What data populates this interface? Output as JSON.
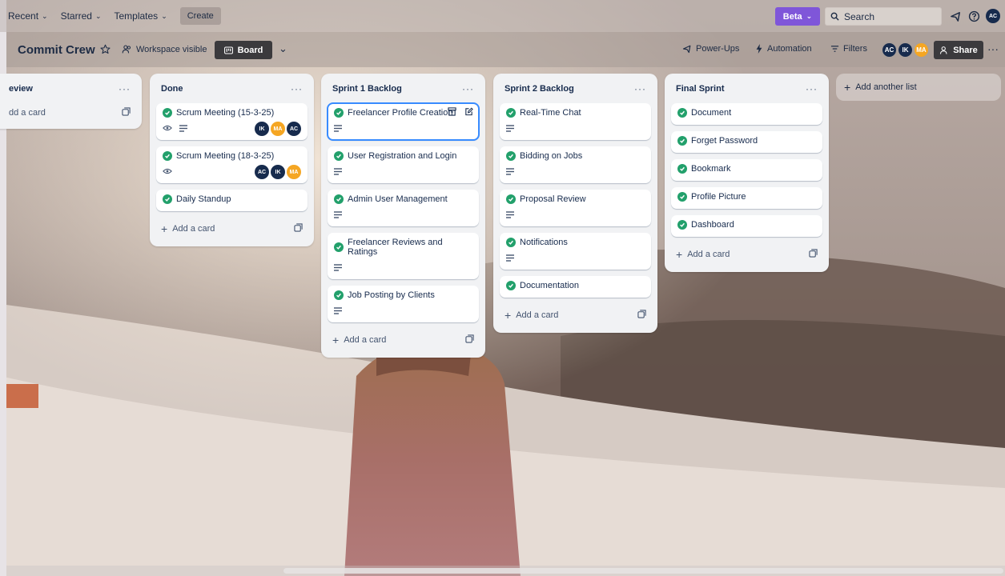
{
  "topnav": {
    "recent": "Recent",
    "starred": "Starred",
    "templates": "Templates",
    "create": "Create",
    "beta": "Beta",
    "search_placeholder": "Search",
    "me_initials": "AC"
  },
  "board": {
    "title": "Commit Crew",
    "visibility": "Workspace visible",
    "view": "Board",
    "powerups": "Power-Ups",
    "automation": "Automation",
    "filters": "Filters",
    "members": [
      "AC",
      "IK",
      "MA"
    ],
    "share": "Share"
  },
  "lists": [
    {
      "title": "eview",
      "cards": [],
      "add_label": "dd a card"
    },
    {
      "title": "Done",
      "cards": [
        {
          "title": "Scrum Meeting (15-3-25)",
          "members": [
            "IK",
            "MA",
            "AC"
          ]
        },
        {
          "title": "Scrum Meeting (18-3-25)",
          "members": [
            "AC",
            "IK",
            "MA"
          ]
        },
        {
          "title": "Daily Standup",
          "members": []
        }
      ],
      "add_label": "Add a card"
    },
    {
      "title": "Sprint 1 Backlog",
      "cards": [
        {
          "title": "Freelancer Profile Creation"
        },
        {
          "title": "User Registration and Login"
        },
        {
          "title": "Admin User Management"
        },
        {
          "title": "Freelancer Reviews and Ratings"
        },
        {
          "title": "Job Posting by Clients"
        }
      ],
      "add_label": "Add a card"
    },
    {
      "title": "Sprint 2 Backlog",
      "cards": [
        {
          "title": "Real-Time Chat"
        },
        {
          "title": "Bidding on Jobs"
        },
        {
          "title": "Proposal Review"
        },
        {
          "title": "Notifications"
        },
        {
          "title": "Documentation"
        }
      ],
      "add_label": "Add a card"
    },
    {
      "title": "Final Sprint",
      "cards": [
        {
          "title": "Document"
        },
        {
          "title": "Forget Password"
        },
        {
          "title": "Bookmark"
        },
        {
          "title": "Profile Picture"
        },
        {
          "title": "Dashboard"
        }
      ],
      "add_label": "Add a card"
    }
  ],
  "add_list": "Add another list",
  "colors": {
    "beta": "#7f56d9",
    "check": "#22a06b",
    "avatar_dark": "#172b4d",
    "avatar_orange": "#f5a623",
    "selected_outline": "#388bff"
  }
}
